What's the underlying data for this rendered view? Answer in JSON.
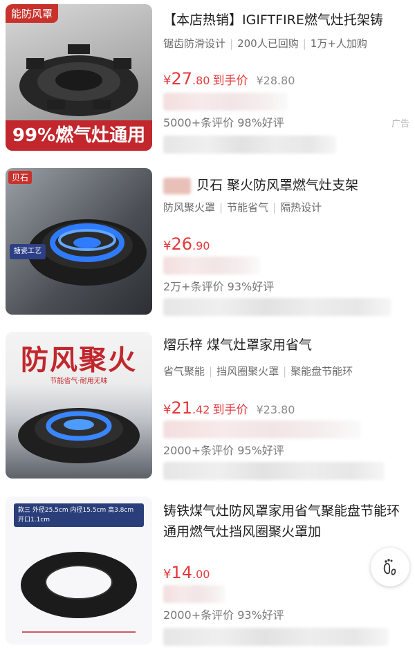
{
  "products": [
    {
      "title": "【本店热销】IGIFTFIRE燃气灶托架铸",
      "tags": [
        "锯齿防滑设计",
        "200人已回购",
        "1万+人加购"
      ],
      "price": {
        "yen": "¥",
        "int": "27",
        "dec": ".80",
        "deal": "到手价",
        "orig": "¥28.80"
      },
      "reviews": "5000+条评价  98%好评",
      "ad": "广告",
      "thumb": {
        "badge": "能防风罩",
        "bottom": "99%燃气灶通用"
      }
    },
    {
      "title": "贝石 聚火防风罩燃气灶支架",
      "tags": [
        "防风聚火罩",
        "节能省气",
        "隔热设计"
      ],
      "price": {
        "yen": "¥",
        "int": "26",
        "dec": ".90"
      },
      "reviews": "2万+条评价  93%好评",
      "thumb": {
        "brand": "贝石",
        "tag": "搪瓷工艺"
      }
    },
    {
      "title": "熠乐梓 煤气灶罩家用省气",
      "tags": [
        "省气聚能",
        "挡风圈聚火罩",
        "聚能盘节能环"
      ],
      "price": {
        "yen": "¥",
        "int": "21",
        "dec": ".42",
        "deal": "到手价",
        "orig": "¥23.80"
      },
      "reviews": "2000+条评价  95%好评",
      "thumb": {
        "big": "防风聚火",
        "sub": "节能省气·耐用无味"
      }
    },
    {
      "title": "铸铁煤气灶防风罩家用省气聚能盘节能环通用燃气灶挡风圈聚火罩加",
      "price": {
        "yen": "¥",
        "int": "14",
        "dec": ".00"
      },
      "reviews": "2000+条评价  93%好评",
      "thumb": {
        "dims": "款三  外径25.5cm 内径15.5cm 高3.8cm 开口1.1cm"
      }
    }
  ],
  "colors": {
    "price": "#e4393c",
    "accent_red": "#c1272d"
  },
  "float_button": {
    "icon": "footprint-icon"
  }
}
